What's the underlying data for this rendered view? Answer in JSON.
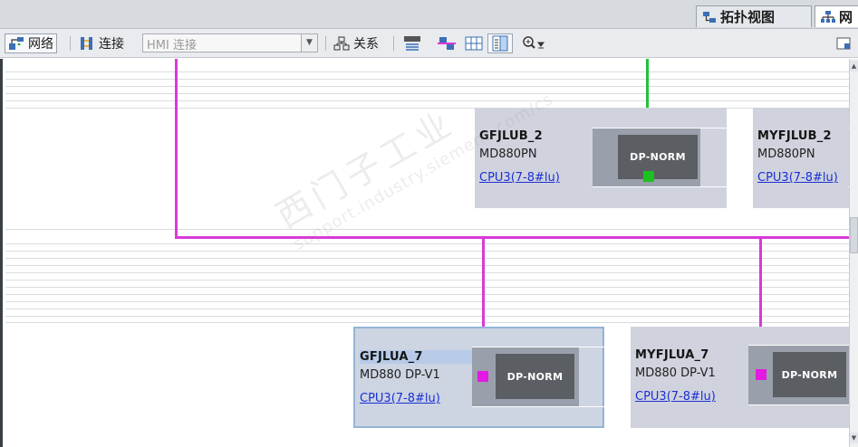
{
  "view_tabs": {
    "topology_label": "拓扑视图",
    "network_label": "网"
  },
  "toolbar": {
    "network_label": "网络",
    "connection_label": "连接",
    "connection_type_placeholder": "HMI 连接",
    "relation_label": "关系"
  },
  "stations": [
    {
      "name": "GFJLUB_2",
      "type": "MD880PN",
      "link": "CPU3(7-8#lu)",
      "module": "DP-NORM",
      "port_color": "#19c21e"
    },
    {
      "name": "MYFJLUB_2",
      "type": "MD880PN",
      "link": "CPU3(7-8#lu)"
    },
    {
      "name": "GFJLUA_7",
      "type": "MD880 DP-V1",
      "link": "CPU3(7-8#lu)",
      "module": "DP-NORM",
      "port_color": "#e21ae2"
    },
    {
      "name": "MYFJLUA_7",
      "type": "MD880 DP-V1",
      "link": "CPU3(7-8#lu)",
      "module": "DP-NORM",
      "port_color": "#e21ae2"
    }
  ],
  "colors": {
    "profibus": "#d83ad8",
    "profinet": "#20c23c",
    "station_bg": "#d0d3dd"
  },
  "watermark": {
    "line1": "西门子工业",
    "line2": "support.industry.siemens.com/cs"
  }
}
